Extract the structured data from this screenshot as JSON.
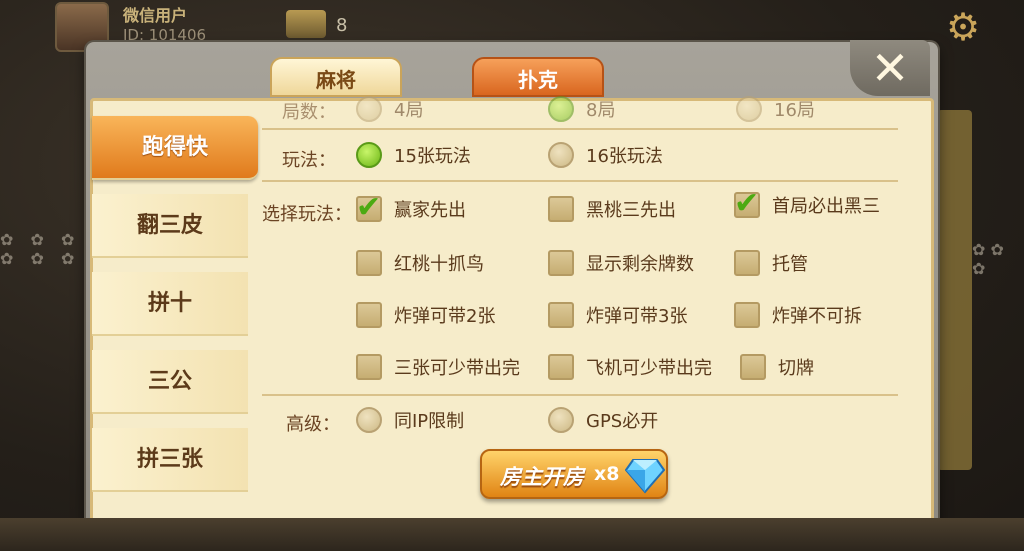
{
  "background": {
    "player_name": "微信用户",
    "player_id": "ID: 101406",
    "gold_count": "8"
  },
  "tabs": [
    {
      "label": "麻将",
      "active": false
    },
    {
      "label": "扑克",
      "active": true
    }
  ],
  "close_symbol": "✕",
  "games": [
    {
      "label": "跑得快",
      "active": true
    },
    {
      "label": "翻三皮",
      "active": false
    },
    {
      "label": "拼十",
      "active": false
    },
    {
      "label": "三公",
      "active": false
    },
    {
      "label": "拼三张",
      "active": false
    }
  ],
  "rounds": {
    "label": "局数：",
    "options": [
      {
        "label": "4局",
        "selected": false
      },
      {
        "label": "8局",
        "selected": true
      },
      {
        "label": "16局",
        "selected": false
      }
    ]
  },
  "play_mode": {
    "label": "玩法：",
    "options": [
      {
        "label": "15张玩法",
        "selected": true
      },
      {
        "label": "16张玩法",
        "selected": false
      }
    ]
  },
  "rules": {
    "label": "选择玩法：",
    "options": [
      {
        "label": "赢家先出",
        "checked": true
      },
      {
        "label": "黑桃三先出",
        "checked": false
      },
      {
        "label": "首局必出黑三",
        "checked": true
      },
      {
        "label": "红桃十抓鸟",
        "checked": false
      },
      {
        "label": "显示剩余牌数",
        "checked": false
      },
      {
        "label": "托管",
        "checked": false
      },
      {
        "label": "炸弹可带2张",
        "checked": false
      },
      {
        "label": "炸弹可带3张",
        "checked": false
      },
      {
        "label": "炸弹不可拆",
        "checked": false
      },
      {
        "label": "三张可少带出完",
        "checked": false
      },
      {
        "label": "飞机可少带出完",
        "checked": false
      },
      {
        "label": "切牌",
        "checked": false
      }
    ]
  },
  "advanced": {
    "label": "高级：",
    "options": [
      {
        "label": "同IP限制",
        "selected": false
      },
      {
        "label": "GPS必开",
        "selected": false
      }
    ]
  },
  "create_button": {
    "label": "房主开房",
    "cost": "x8"
  },
  "colors": {
    "panel": "#f6ecca",
    "active_tab": "#e07a1c",
    "radio_on": "#6cb614"
  }
}
